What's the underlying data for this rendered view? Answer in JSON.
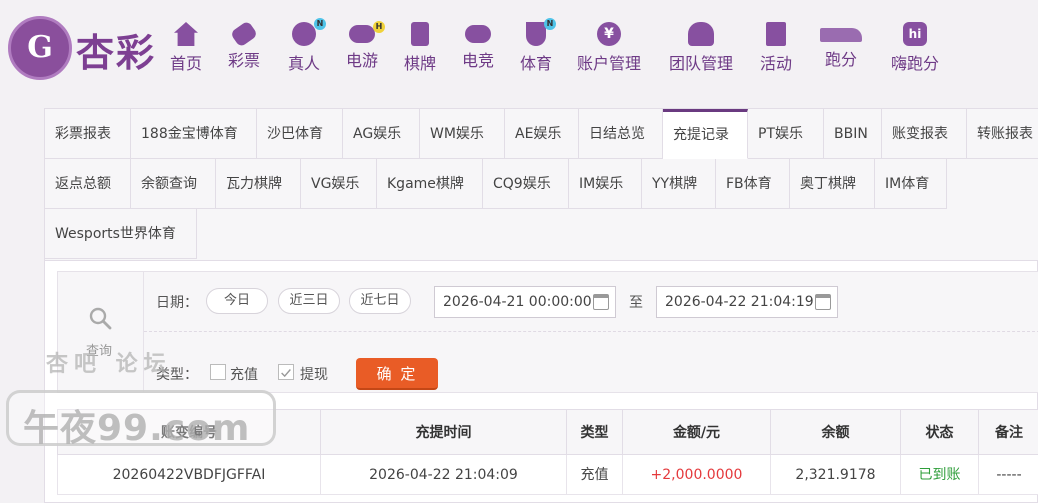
{
  "brand": {
    "logo_letter": "G",
    "name": "杏彩"
  },
  "nav": [
    {
      "label": "首页",
      "icon": "home-icon",
      "badge": ""
    },
    {
      "label": "彩票",
      "icon": "ticket-icon",
      "badge": ""
    },
    {
      "label": "真人",
      "icon": "dealer-icon",
      "badge": "N"
    },
    {
      "label": "电游",
      "icon": "gamepad-icon",
      "badge": "H"
    },
    {
      "label": "棋牌",
      "icon": "cards-icon",
      "badge": ""
    },
    {
      "label": "电竞",
      "icon": "esports-controller-icon",
      "badge": ""
    },
    {
      "label": "体育",
      "icon": "trophy-icon",
      "badge": "N"
    },
    {
      "label": "账户管理",
      "icon": "yen-circle-icon",
      "badge": ""
    },
    {
      "label": "团队管理",
      "icon": "team-icon",
      "badge": ""
    },
    {
      "label": "活动",
      "icon": "gift-icon",
      "badge": ""
    },
    {
      "label": "跑分",
      "icon": "runner-icon",
      "badge": ""
    },
    {
      "label": "嗨跑分",
      "icon": "hi-app-icon",
      "badge": ""
    }
  ],
  "tabs": {
    "row1": [
      "彩票报表",
      "188金宝博体育",
      "沙巴体育",
      "AG娱乐",
      "WM娱乐",
      "AE娱乐",
      "日结总览",
      "充提记录",
      "PT娱乐",
      "BBIN",
      "账变报表",
      "转账报表"
    ],
    "row2": [
      "返点总额",
      "余额查询",
      "瓦力棋牌",
      "VG娱乐",
      "Kgame棋牌",
      "CQ9娱乐",
      "IM娱乐",
      "YY棋牌",
      "FB体育",
      "奥丁棋牌",
      "IM体育"
    ],
    "row3": [
      "Wesports世界体育"
    ],
    "active": "充提记录"
  },
  "filter": {
    "search_label": "查询",
    "date_label": "日期：",
    "quick_ranges": [
      "今日",
      "近三日",
      "近七日"
    ],
    "start_date": "2026-04-21 00:00:00",
    "to_label": "至",
    "end_date": "2026-04-22 21:04:19",
    "type_label": "类型：",
    "type_options": [
      {
        "label": "充值",
        "checked": false
      },
      {
        "label": "提现",
        "checked": true
      }
    ],
    "confirm_label": "确 定"
  },
  "table": {
    "columns": [
      "账变编号",
      "充提时间",
      "类型",
      "金额/元",
      "余额",
      "状态",
      "备注"
    ],
    "rows": [
      {
        "id": "20260422VBDFJGFFAI",
        "time": "2026-04-22 21:04:09",
        "type": "充值",
        "amount": "+2,000.0000",
        "balance": "2,321.9178",
        "status": "已到账",
        "note": "-----"
      }
    ]
  },
  "watermark": {
    "top": "杏吧 论坛",
    "main": "午夜99.com"
  },
  "colors": {
    "brand_purple": "#7d3f92",
    "confirm_orange": "#e95c26",
    "amount_red": "#e4393c",
    "status_green": "#2e9e3a"
  }
}
